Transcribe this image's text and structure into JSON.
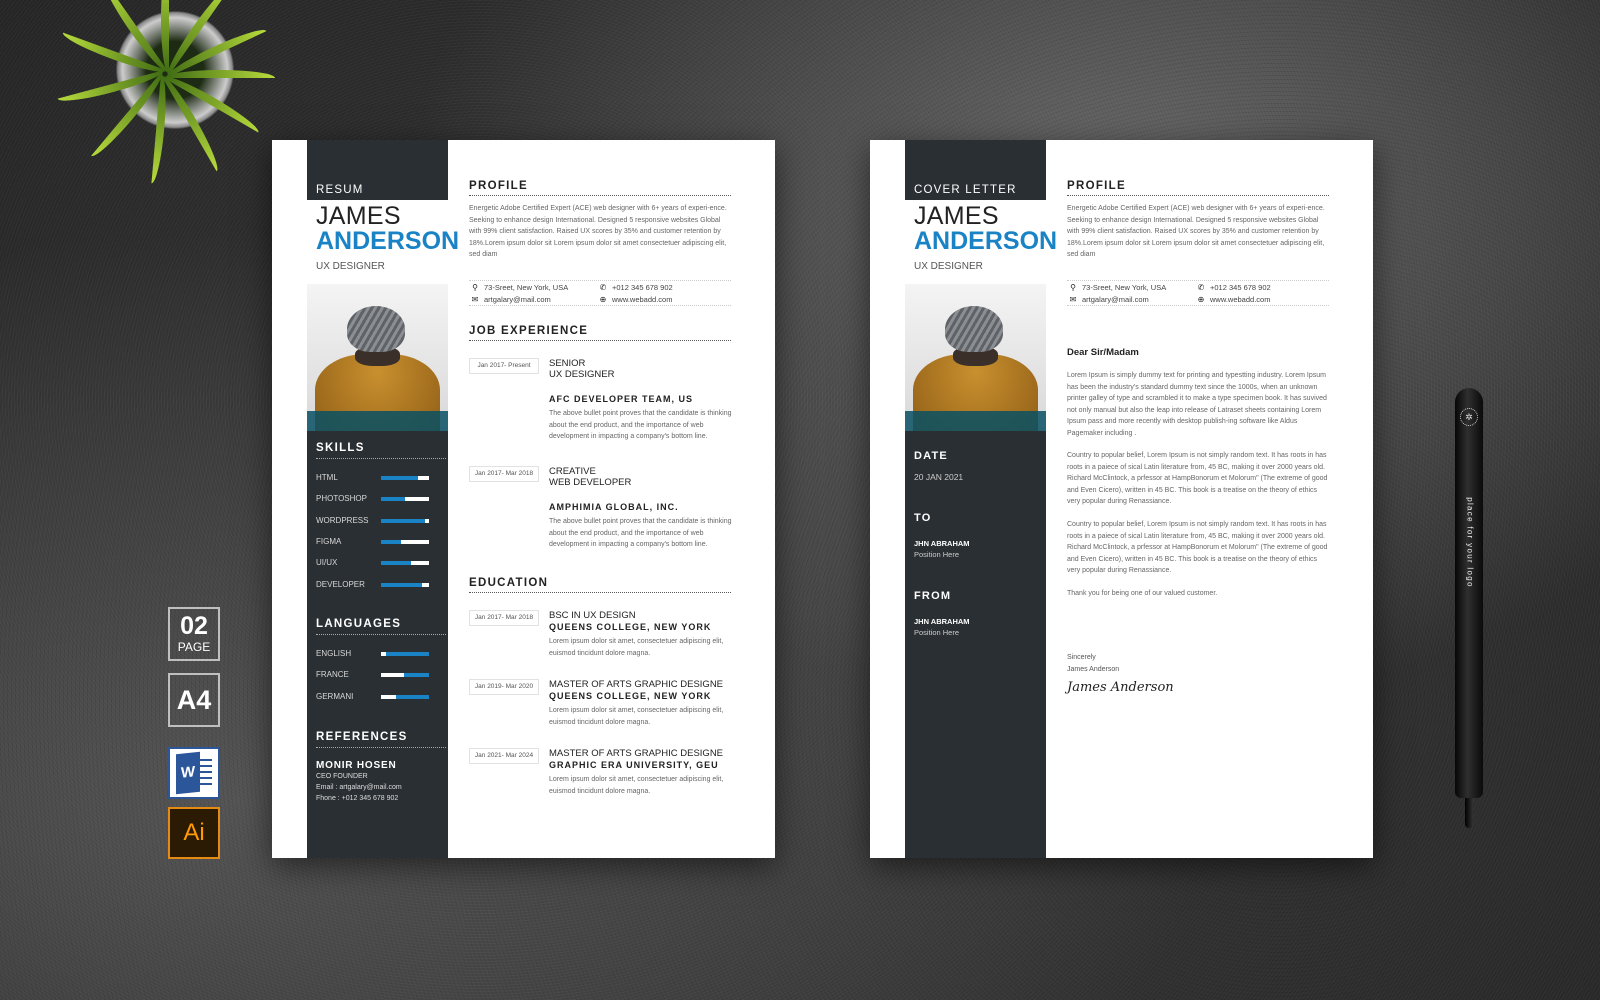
{
  "badges": {
    "pages_count": "02",
    "pages_label": "PAGE",
    "paper_size": "A4",
    "word_icon": "W",
    "ai_icon": "Ai"
  },
  "pen": {
    "text": "place for your logo",
    "logo_icon": "✲"
  },
  "resume": {
    "header": "RESUM",
    "first_name": "JAMES",
    "last_name": "ANDERSON",
    "job_title": "UX DESIGNER",
    "skills": {
      "title": "SKILLS",
      "items": [
        {
          "label": "HTML",
          "level": 0.78
        },
        {
          "label": "PHOTOSHOP",
          "level": 0.5
        },
        {
          "label": "WORDPRESS",
          "level": 0.92
        },
        {
          "label": "FIGMA",
          "level": 0.42
        },
        {
          "label": "UI/UX",
          "level": 0.63
        },
        {
          "label": "DEVELOPER",
          "level": 0.85
        }
      ]
    },
    "languages": {
      "title": "LANGUAGES",
      "items": [
        {
          "label": "ENGLISH",
          "level": 0.9
        },
        {
          "label": "FRANCE",
          "level": 0.53
        },
        {
          "label": "GERMANI",
          "level": 0.68
        }
      ]
    },
    "references": {
      "title": "REFERENCES",
      "name": "MONIR HOSEN",
      "role": "CEO FOUNDER",
      "email": "Email : artgalary@mail.com",
      "phone": "Fhone : +012 345 678 902"
    },
    "profile": {
      "title": "PROFILE",
      "text": "Energetic Adobe Certified Expert (ACE) web designer with 6+ years of experi-ence. Seeking to enhance design International. Designed 5 responsive websites Global with 99% client satisfaction. Raised UX scores by 35% and customer retention by 18%.Lorem ipsum dolor sit Lorem ipsum dolor sit amet consectetuer adipiscing elit, sed diam"
    },
    "contact": {
      "address": "73-Sreet, New York, USA",
      "phone": "+012 345 678 902",
      "email": "artgalary@mail.com",
      "web": "www.webadd.com"
    },
    "experience": {
      "title": "JOB EXPERIENCE",
      "items": [
        {
          "date": "Jan 2017- Present",
          "role_line1": "SENIOR",
          "role_line2": " UX DESIGNER",
          "company": "AFC DEVELOPER TEAM, US",
          "desc": "The above bullet point proves that the candidate is thinking about the end product, and the importance of web development in impacting a company's bottom line."
        },
        {
          "date": "Jan 2017- Mar 2018",
          "role_line1": "CREATIVE",
          "role_line2": "WEB DEVELOPER",
          "company": "AMPHIMIA GLOBAL, INC.",
          "desc": "The above bullet point proves that the candidate is thinking about the end product, and the importance of web development in impacting a company's bottom line."
        }
      ]
    },
    "education": {
      "title": "EDUCATION",
      "items": [
        {
          "date": "Jan 2017- Mar 2018",
          "degree": "BSC IN UX DESIGN",
          "school": "QUEENS COLLEGE, NEW YORK",
          "desc": "Lorem ipsum dolor sit amet, consectetuer adipiscing elit, euismod tincidunt dolore magna."
        },
        {
          "date": "Jan 2019- Mar 2020",
          "degree": "MASTER OF ARTS GRAPHIC DESIGNE",
          "school": "QUEENS COLLEGE, NEW YORK",
          "desc": "Lorem ipsum dolor sit amet, consectetuer adipiscing elit, euismod tincidunt dolore magna."
        },
        {
          "date": "Jan 2021- Mar 2024",
          "degree": "MASTER OF ARTS GRAPHIC DESIGNE",
          "school": "GRAPHIC ERA UNIVERSITY, GEU",
          "desc": "Lorem ipsum dolor sit amet, consectetuer adipiscing elit, euismod tincidunt dolore magna."
        }
      ]
    }
  },
  "cover": {
    "header": "COVER LETTER",
    "first_name": "JAMES",
    "last_name": "ANDERSON",
    "job_title": "UX DESIGNER",
    "date_label": "DATE",
    "date_value": "20 JAN 2021",
    "to_label": "TO",
    "to_name": "JHN ABRAHAM",
    "to_position": "Position Here",
    "from_label": "FROM",
    "from_name": "JHN ABRAHAM",
    "from_position": "Position Here",
    "greeting": "Dear Sir/Madam",
    "paragraphs": [
      "Lorem Ipsum is simply dummy text for printing and typestting industry. Lorem Ipsum has been the industry's standard dummy text since the 1000s, when an unknown printer galley of type and scrambled it to make a type specimen book. It has suvived not only manual but also the leap into release of Latraset sheets containing Lorem Ipsum pass and more recently with desktop publish-ing software like Aldus Pagemaker including .",
      "Country to popular belief, Lorem Ipsum is not simply random text. It has roots in has roots in a paiece of sical  Latin literature from, 45 BC, making it over 2000 years old. Richard McClintock, a prfessor at HampBonorum et Molorum\" (The extreme of good and Even Cicero), written in 45 BC. This book is a treatise on the theory of ethics very popular during  Renassiance.",
      "Country to popular belief, Lorem Ipsum is not simply random text. It has roots in  has roots in a paiece of sical  Latin literature from, 45 BC, making it over 2000 years old. Richard McClintock, a prfessor at HampBonorum et Molorum\" (The extreme of good and Even Cicero), written in 45 BC. This book is a treatise on the theory of ethics very popular during  Renassiance.",
      "Thank you for being one of our valued customer."
    ],
    "closing": "Sincerely",
    "signer": "James Anderson",
    "signature": "James Anderson"
  }
}
